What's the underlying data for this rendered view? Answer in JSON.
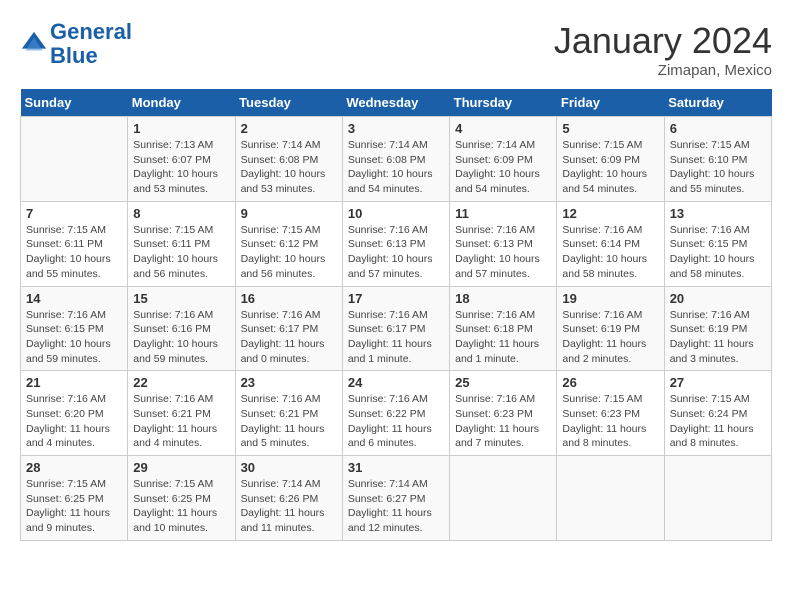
{
  "header": {
    "logo_line1": "General",
    "logo_line2": "Blue",
    "month": "January 2024",
    "location": "Zimapan, Mexico"
  },
  "days_of_week": [
    "Sunday",
    "Monday",
    "Tuesday",
    "Wednesday",
    "Thursday",
    "Friday",
    "Saturday"
  ],
  "weeks": [
    [
      {
        "num": "",
        "info": ""
      },
      {
        "num": "1",
        "info": "Sunrise: 7:13 AM\nSunset: 6:07 PM\nDaylight: 10 hours\nand 53 minutes."
      },
      {
        "num": "2",
        "info": "Sunrise: 7:14 AM\nSunset: 6:08 PM\nDaylight: 10 hours\nand 53 minutes."
      },
      {
        "num": "3",
        "info": "Sunrise: 7:14 AM\nSunset: 6:08 PM\nDaylight: 10 hours\nand 54 minutes."
      },
      {
        "num": "4",
        "info": "Sunrise: 7:14 AM\nSunset: 6:09 PM\nDaylight: 10 hours\nand 54 minutes."
      },
      {
        "num": "5",
        "info": "Sunrise: 7:15 AM\nSunset: 6:09 PM\nDaylight: 10 hours\nand 54 minutes."
      },
      {
        "num": "6",
        "info": "Sunrise: 7:15 AM\nSunset: 6:10 PM\nDaylight: 10 hours\nand 55 minutes."
      }
    ],
    [
      {
        "num": "7",
        "info": "Sunrise: 7:15 AM\nSunset: 6:11 PM\nDaylight: 10 hours\nand 55 minutes."
      },
      {
        "num": "8",
        "info": "Sunrise: 7:15 AM\nSunset: 6:11 PM\nDaylight: 10 hours\nand 56 minutes."
      },
      {
        "num": "9",
        "info": "Sunrise: 7:15 AM\nSunset: 6:12 PM\nDaylight: 10 hours\nand 56 minutes."
      },
      {
        "num": "10",
        "info": "Sunrise: 7:16 AM\nSunset: 6:13 PM\nDaylight: 10 hours\nand 57 minutes."
      },
      {
        "num": "11",
        "info": "Sunrise: 7:16 AM\nSunset: 6:13 PM\nDaylight: 10 hours\nand 57 minutes."
      },
      {
        "num": "12",
        "info": "Sunrise: 7:16 AM\nSunset: 6:14 PM\nDaylight: 10 hours\nand 58 minutes."
      },
      {
        "num": "13",
        "info": "Sunrise: 7:16 AM\nSunset: 6:15 PM\nDaylight: 10 hours\nand 58 minutes."
      }
    ],
    [
      {
        "num": "14",
        "info": "Sunrise: 7:16 AM\nSunset: 6:15 PM\nDaylight: 10 hours\nand 59 minutes."
      },
      {
        "num": "15",
        "info": "Sunrise: 7:16 AM\nSunset: 6:16 PM\nDaylight: 10 hours\nand 59 minutes."
      },
      {
        "num": "16",
        "info": "Sunrise: 7:16 AM\nSunset: 6:17 PM\nDaylight: 11 hours\nand 0 minutes."
      },
      {
        "num": "17",
        "info": "Sunrise: 7:16 AM\nSunset: 6:17 PM\nDaylight: 11 hours\nand 1 minute."
      },
      {
        "num": "18",
        "info": "Sunrise: 7:16 AM\nSunset: 6:18 PM\nDaylight: 11 hours\nand 1 minute."
      },
      {
        "num": "19",
        "info": "Sunrise: 7:16 AM\nSunset: 6:19 PM\nDaylight: 11 hours\nand 2 minutes."
      },
      {
        "num": "20",
        "info": "Sunrise: 7:16 AM\nSunset: 6:19 PM\nDaylight: 11 hours\nand 3 minutes."
      }
    ],
    [
      {
        "num": "21",
        "info": "Sunrise: 7:16 AM\nSunset: 6:20 PM\nDaylight: 11 hours\nand 4 minutes."
      },
      {
        "num": "22",
        "info": "Sunrise: 7:16 AM\nSunset: 6:21 PM\nDaylight: 11 hours\nand 4 minutes."
      },
      {
        "num": "23",
        "info": "Sunrise: 7:16 AM\nSunset: 6:21 PM\nDaylight: 11 hours\nand 5 minutes."
      },
      {
        "num": "24",
        "info": "Sunrise: 7:16 AM\nSunset: 6:22 PM\nDaylight: 11 hours\nand 6 minutes."
      },
      {
        "num": "25",
        "info": "Sunrise: 7:16 AM\nSunset: 6:23 PM\nDaylight: 11 hours\nand 7 minutes."
      },
      {
        "num": "26",
        "info": "Sunrise: 7:15 AM\nSunset: 6:23 PM\nDaylight: 11 hours\nand 8 minutes."
      },
      {
        "num": "27",
        "info": "Sunrise: 7:15 AM\nSunset: 6:24 PM\nDaylight: 11 hours\nand 8 minutes."
      }
    ],
    [
      {
        "num": "28",
        "info": "Sunrise: 7:15 AM\nSunset: 6:25 PM\nDaylight: 11 hours\nand 9 minutes."
      },
      {
        "num": "29",
        "info": "Sunrise: 7:15 AM\nSunset: 6:25 PM\nDaylight: 11 hours\nand 10 minutes."
      },
      {
        "num": "30",
        "info": "Sunrise: 7:14 AM\nSunset: 6:26 PM\nDaylight: 11 hours\nand 11 minutes."
      },
      {
        "num": "31",
        "info": "Sunrise: 7:14 AM\nSunset: 6:27 PM\nDaylight: 11 hours\nand 12 minutes."
      },
      {
        "num": "",
        "info": ""
      },
      {
        "num": "",
        "info": ""
      },
      {
        "num": "",
        "info": ""
      }
    ]
  ]
}
